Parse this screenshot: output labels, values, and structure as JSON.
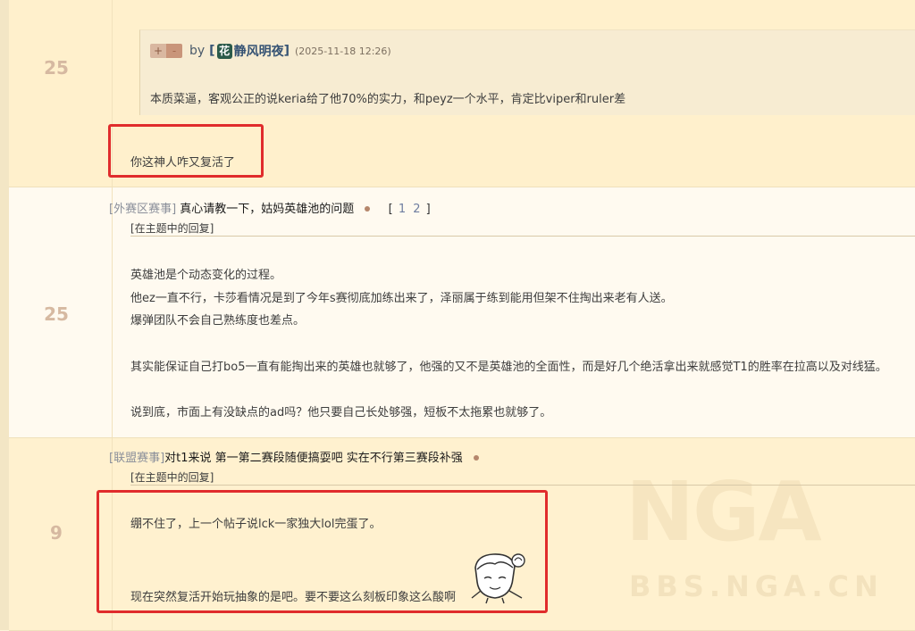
{
  "posts": [
    {
      "count": "25",
      "quote": {
        "plus": "+",
        "minus": "-",
        "by": "by",
        "author_badge": "花",
        "author": "静风明夜",
        "open_bracket": "[",
        "close_bracket": "]",
        "time": "(2025-11-18 12:26)",
        "text": "本质菜逼，客观公正的说keria给了他70%的实力，和peyz一个水平，肯定比viper和ruler差"
      },
      "reply": "你这神人咋又复活了"
    },
    {
      "count": "25",
      "forum": "[外赛区赛事]",
      "title": "真心请教一下，姑妈英雄池的问题",
      "pages": {
        "open": "[",
        "p1": "1",
        "p2": "2",
        "close": "]"
      },
      "in_topic": "[在主题中的回复]",
      "lines": [
        "英雄池是个动态变化的过程。",
        "他ez一直不行，卡莎看情况是到了今年s赛彻底加练出来了，泽丽属于练到能用但架不住掏出来老有人送。",
        "爆弹团队不会自己熟练度也差点。",
        "其实能保证自己打bo5一直有能掏出来的英雄也就够了，他强的又不是英雄池的全面性，而是好几个绝活拿出来就感觉T1的胜率在拉高以及对线猛。",
        "说到底，市面上有没缺点的ad吗？他只要自己长处够强，短板不太拖累也就够了。"
      ]
    },
    {
      "count": "9",
      "forum": "[联盟赛事]",
      "title": "对t1来说 第一第二赛段随便搞耍吧 实在不行第三赛段补强",
      "in_topic": "[在主题中的回复]",
      "lines": [
        "绷不住了，上一个帖子说lck一家独大lol完蛋了。",
        "现在突然复活开始玩抽象的是吧。要不要这么刻板印象这么酸啊"
      ]
    }
  ],
  "watermark": {
    "logo": "NGA",
    "url": "BBS.NGA.CN"
  },
  "colors": {
    "highlight": "#e02c2c",
    "count": "#d6b9a1",
    "author": "#365374"
  }
}
